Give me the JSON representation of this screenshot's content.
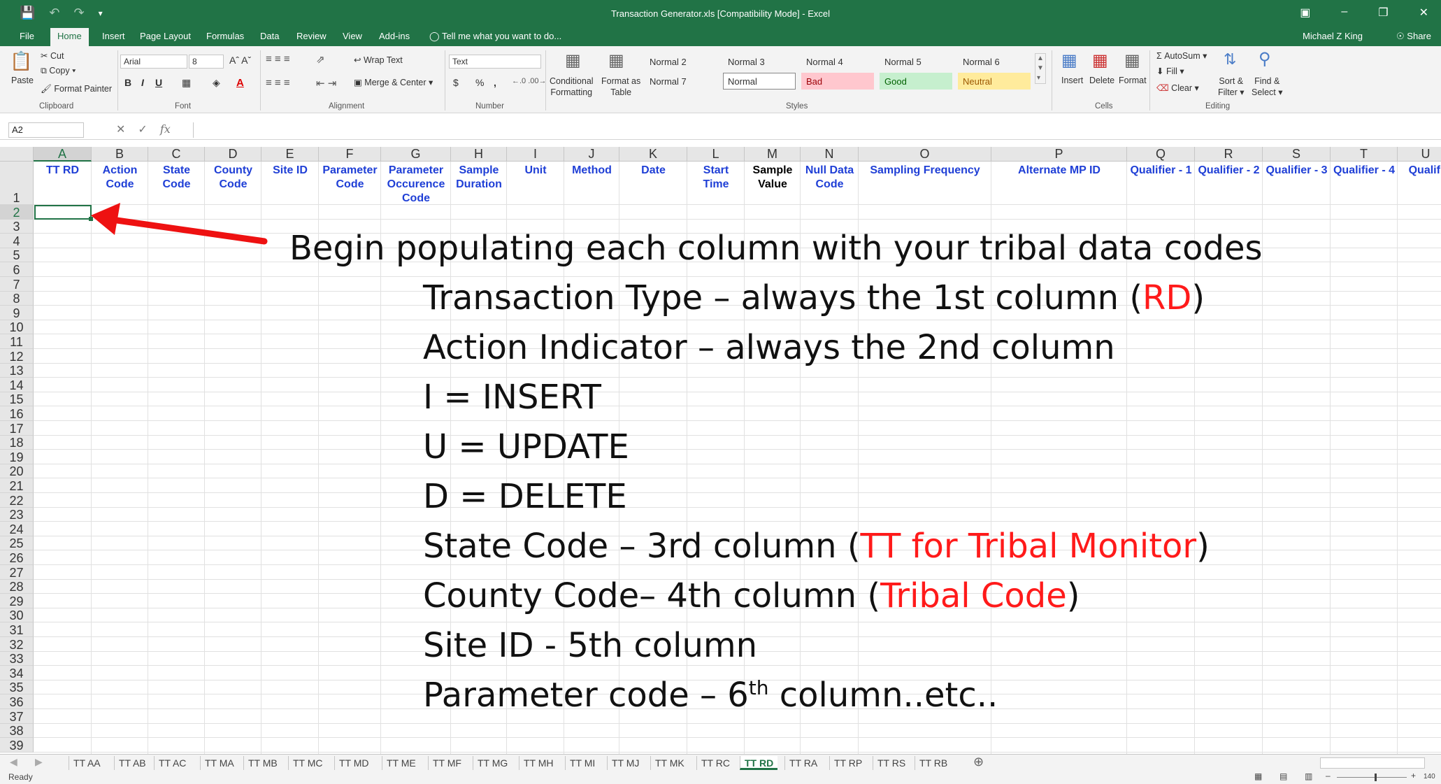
{
  "window": {
    "title": "Transaction Generator.xls  [Compatibility Mode] - Excel",
    "user": "Michael Z King",
    "share": "Share"
  },
  "tabs": [
    "File",
    "Home",
    "Insert",
    "Page Layout",
    "Formulas",
    "Data",
    "Review",
    "View",
    "Add-ins"
  ],
  "tell_me": "Tell me what you want to do...",
  "ribbon": {
    "clipboard": {
      "paste": "Paste",
      "cut": "Cut",
      "copy": "Copy",
      "format_painter": "Format Painter",
      "label": "Clipboard"
    },
    "font": {
      "name": "Arial",
      "size": "8",
      "label": "Font"
    },
    "alignment": {
      "wrap": "Wrap Text",
      "merge": "Merge & Center",
      "label": "Alignment"
    },
    "number": {
      "format": "Text",
      "currency": "$",
      "percent": "%",
      "comma": ",",
      "label": "Number"
    },
    "styles": {
      "conditional": "Conditional",
      "formatting": "Formatting",
      "format_as": "Format as",
      "table": "Table",
      "cells": [
        {
          "name": "Normal 2",
          "bg": "#ffffff",
          "color": "#222222"
        },
        {
          "name": "Normal 3",
          "bg": "#ffffff",
          "color": "#222222"
        },
        {
          "name": "Normal 4",
          "bg": "#ffffff",
          "color": "#222222"
        },
        {
          "name": "Normal 5",
          "bg": "#ffffff",
          "color": "#222222"
        },
        {
          "name": "Normal 6",
          "bg": "#ffffff",
          "color": "#222222"
        },
        {
          "name": "Normal 7",
          "bg": "#ffffff",
          "color": "#222222"
        },
        {
          "name": "Normal",
          "bg": "#ffffff",
          "color": "#222222"
        },
        {
          "name": "Bad",
          "bg": "#ffc7ce",
          "color": "#9c0006"
        },
        {
          "name": "Good",
          "bg": "#c6efce",
          "color": "#006100"
        },
        {
          "name": "Neutral",
          "bg": "#ffeb9c",
          "color": "#9c5700"
        }
      ],
      "label": "Styles"
    },
    "cells": {
      "insert": "Insert",
      "delete": "Delete",
      "format": "Format",
      "label": "Cells"
    },
    "editing": {
      "autosum": "AutoSum",
      "fill": "Fill",
      "clear": "Clear",
      "sort": "Sort &",
      "filter": "Filter",
      "find": "Find &",
      "select": "Select",
      "label": "Editing"
    }
  },
  "name_box": "A2",
  "columns": [
    "A",
    "B",
    "C",
    "D",
    "E",
    "F",
    "G",
    "H",
    "I",
    "J",
    "K",
    "L",
    "M",
    "N",
    "O",
    "P",
    "Q",
    "R",
    "S",
    "T",
    "U"
  ],
  "header_row": [
    [
      "TT RD"
    ],
    [
      "Action",
      "Code"
    ],
    [
      "State",
      "Code"
    ],
    [
      "County",
      "Code"
    ],
    [
      "Site ID"
    ],
    [
      "Parameter",
      "Code"
    ],
    [
      "Parameter",
      "Occurence",
      "Code"
    ],
    [
      "Sample",
      "Duration"
    ],
    [
      "Unit"
    ],
    [
      "Method"
    ],
    [
      "Date"
    ],
    [
      "Start",
      "Time"
    ],
    [
      "Sample",
      "Value"
    ],
    [
      "Null Data",
      "Code"
    ],
    [
      "Sampling Frequency"
    ],
    [
      "Alternate MP ID"
    ],
    [
      "Qualifier - 1"
    ],
    [
      "Qualifier - 2"
    ],
    [
      "Qualifier - 3"
    ],
    [
      "Qualifier - 4"
    ],
    [
      "Qualifi"
    ]
  ],
  "rows": [
    "1",
    "2",
    "3",
    "4",
    "5",
    "6",
    "7",
    "8",
    "9",
    "10",
    "11",
    "12",
    "13",
    "14",
    "15",
    "16",
    "17",
    "18",
    "19",
    "20",
    "21",
    "22",
    "23",
    "24",
    "25",
    "26",
    "27",
    "28",
    "29",
    "30",
    "31",
    "32",
    "33",
    "34",
    "35",
    "36",
    "37",
    "38",
    "39"
  ],
  "annotation": {
    "heading": "Begin populating each column with your tribal data codes",
    "line1_pre": "Transaction Type – always the 1st column (",
    "line1_red": "RD",
    "line1_post": ")",
    "line2": "Action Indicator – always the 2nd column",
    "line3": "I = INSERT",
    "line4": "U = UPDATE",
    "line5": "D = DELETE",
    "line6_pre": "State Code – 3rd column (",
    "line6_red": "TT for Tribal Monitor",
    "line6_post": ")",
    "line7_pre": "County Code– 4th column (",
    "line7_red": "Tribal Code",
    "line7_post": ")",
    "line8": "Site ID - 5th column",
    "line9_pre": "Parameter code – 6",
    "line9_sup": "th",
    "line9_post": " column..etc..",
    "arrow_color": "#ee1111"
  },
  "sheet_tabs": [
    "TT AA",
    "TT AB",
    "TT AC",
    "TT MA",
    "TT MB",
    "TT MC",
    "TT MD",
    "TT ME",
    "TT MF",
    "TT MG",
    "TT MH",
    "TT MI",
    "TT MJ",
    "TT MK",
    "TT RC",
    "TT RD",
    "TT RA",
    "TT RP",
    "TT RS",
    "TT RB"
  ],
  "active_sheet": "TT RD",
  "status": {
    "ready": "Ready",
    "zoom": "140"
  }
}
